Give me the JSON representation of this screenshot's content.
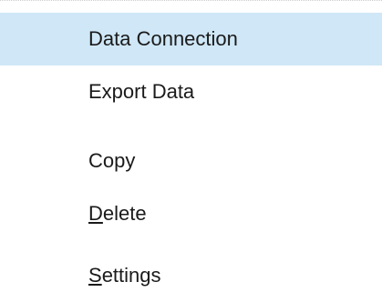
{
  "menu": {
    "items": [
      {
        "label": "Data Connection",
        "highlighted": true
      },
      {
        "label": "Export Data",
        "highlighted": false
      },
      {
        "label": "Copy",
        "highlighted": false
      },
      {
        "mnemonic": "D",
        "rest": "elete",
        "highlighted": false
      },
      {
        "mnemonic": "S",
        "rest": "ettings",
        "highlighted": false
      }
    ]
  },
  "colors": {
    "highlight": "#cfe7f6",
    "text": "#1a1a1a"
  }
}
